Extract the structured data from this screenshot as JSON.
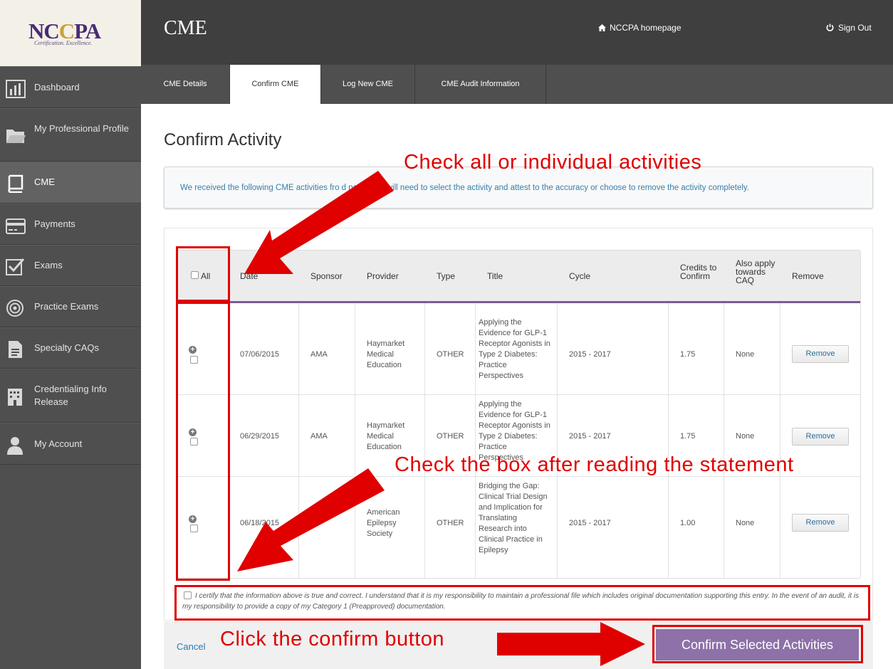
{
  "logo": {
    "text_a": "NC",
    "text_b": "C",
    "text_c": "PA",
    "tagline": "Certification.   Excellence."
  },
  "header": {
    "title": "CME",
    "home_link": "NCCPA homepage",
    "signout": "Sign Out"
  },
  "sidebar": {
    "items": [
      {
        "label": "Dashboard",
        "icon": "bar-chart-icon"
      },
      {
        "label": "My Professional Profile",
        "icon": "folder-icon"
      },
      {
        "label": "CME",
        "icon": "book-icon",
        "active": true
      },
      {
        "label": "Payments",
        "icon": "credit-card-icon"
      },
      {
        "label": "Exams",
        "icon": "checkbox-icon"
      },
      {
        "label": "Practice Exams",
        "icon": "target-icon"
      },
      {
        "label": "Specialty CAQs",
        "icon": "document-icon"
      },
      {
        "label": "Credentialing Info Release",
        "icon": "building-icon"
      },
      {
        "label": "My Account",
        "icon": "user-icon"
      }
    ]
  },
  "tabs": [
    {
      "label": "CME Details"
    },
    {
      "label": "Confirm CME",
      "active": true
    },
    {
      "label": "Log New CME"
    },
    {
      "label": "CME Audit Information"
    }
  ],
  "page": {
    "title": "Confirm Activity",
    "info": "We received the following CME activities fro           d party. You will need to select the activity and attest to the accuracy or choose to remove the activity completely."
  },
  "table": {
    "headers": {
      "all": "All",
      "date": "Date",
      "sponsor": "Sponsor",
      "provider": "Provider",
      "type": "Type",
      "title": "Title",
      "cycle": "Cycle",
      "credits": "Credits to Confirm",
      "caq": "Also apply towards CAQ",
      "remove": "Remove"
    },
    "rows": [
      {
        "date": "07/06/2015",
        "sponsor": "AMA",
        "provider": "Haymarket Medical Education",
        "type": "OTHER",
        "title": "Applying the Evidence for GLP-1 Receptor Agonists in Type 2 Diabetes: Practice Perspectives",
        "cycle": "2015 - 2017",
        "credits": "1.75",
        "caq": "None",
        "remove": "Remove"
      },
      {
        "date": "06/29/2015",
        "sponsor": "AMA",
        "provider": "Haymarket Medical Education",
        "type": "OTHER",
        "title": "Applying the Evidence for GLP-1 Receptor Agonists in Type 2 Diabetes: Practice Perspectives",
        "cycle": "2015 - 2017",
        "credits": "1.75",
        "caq": "None",
        "remove": "Remove"
      },
      {
        "date": "06/18/2015",
        "sponsor": "",
        "provider": "American Epilepsy Society",
        "type": "OTHER",
        "title": "Bridging the Gap: Clinical Trial Design and Implication for Translating Research into Clinical Practice in Epilepsy",
        "cycle": "2015 - 2017",
        "credits": "1.00",
        "caq": "None",
        "remove": "Remove"
      }
    ]
  },
  "certify": "I certify that the information above is true and correct. I understand that it is my responsibility to maintain a professional file which includes original documentation supporting this entry. In the event of an audit, it is my responsibility to provide a copy of my Category 1 (Preapproved) documentation.",
  "footer": {
    "cancel": "Cancel",
    "confirm": "Confirm Selected Activities"
  },
  "annotations": {
    "check_all": "Check all or individual activities",
    "check_box": "Check the box after reading the statement",
    "click_confirm": "Click the confirm button"
  },
  "colors": {
    "accent_purple": "#8e71a8",
    "annotation_red": "#e00000",
    "header_dark": "#3f3f3f",
    "sidebar": "#4f4f4f"
  }
}
